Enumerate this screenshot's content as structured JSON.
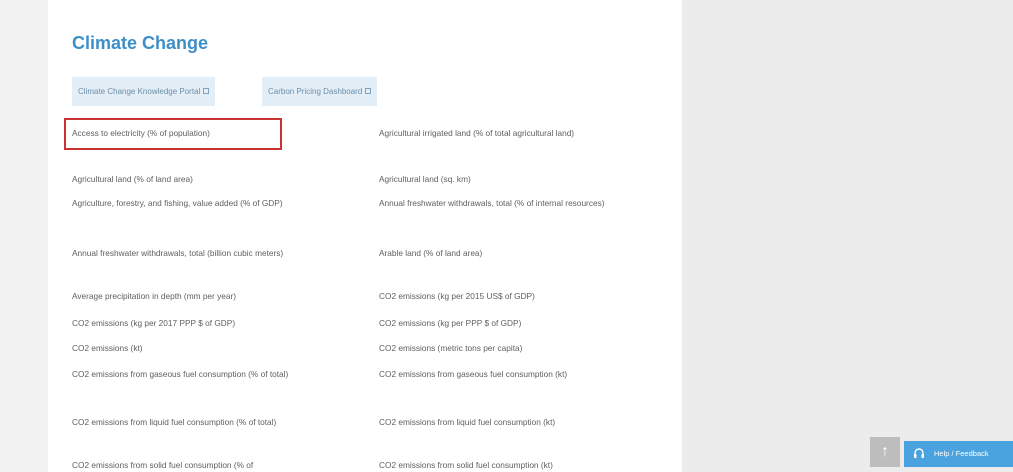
{
  "page_title": "Climate Change",
  "links": [
    {
      "label": "Climate Change Knowledge Portal"
    },
    {
      "label": "Carbon Pricing Dashboard"
    }
  ],
  "indicators_left": [
    "Access to electricity (% of population)",
    "Agricultural land (% of land area)",
    "Agriculture, forestry, and fishing, value added (% of GDP)",
    "Annual freshwater withdrawals, total (billion cubic meters)",
    "Average precipitation in depth (mm per year)",
    "CO2 emissions (kg per 2017 PPP $ of GDP)",
    "CO2 emissions (kt)",
    "CO2 emissions from gaseous fuel consumption (% of total)",
    "CO2 emissions from liquid fuel consumption (% of total)",
    "CO2 emissions from solid fuel consumption (% of"
  ],
  "indicators_right": [
    "Agricultural irrigated land (% of total agricultural land)",
    "Agricultural land (sq. km)",
    "Annual freshwater withdrawals, total (% of internal resources)",
    "Arable land (% of land area)",
    "CO2 emissions (kg per 2015 US$ of GDP)",
    "CO2 emissions (kg per PPP $ of GDP)",
    "CO2 emissions (metric tons per capita)",
    "CO2 emissions from gaseous fuel consumption (kt)",
    "CO2 emissions from liquid fuel consumption (kt)",
    "CO2 emissions from solid fuel consumption (kt)"
  ],
  "footer": {
    "scroll_top_glyph": "↑",
    "help_label": "Help / Feedback"
  },
  "colors": {
    "title": "#3d8fc7",
    "highlight": "#c93333",
    "help_button": "#4aa3df"
  }
}
